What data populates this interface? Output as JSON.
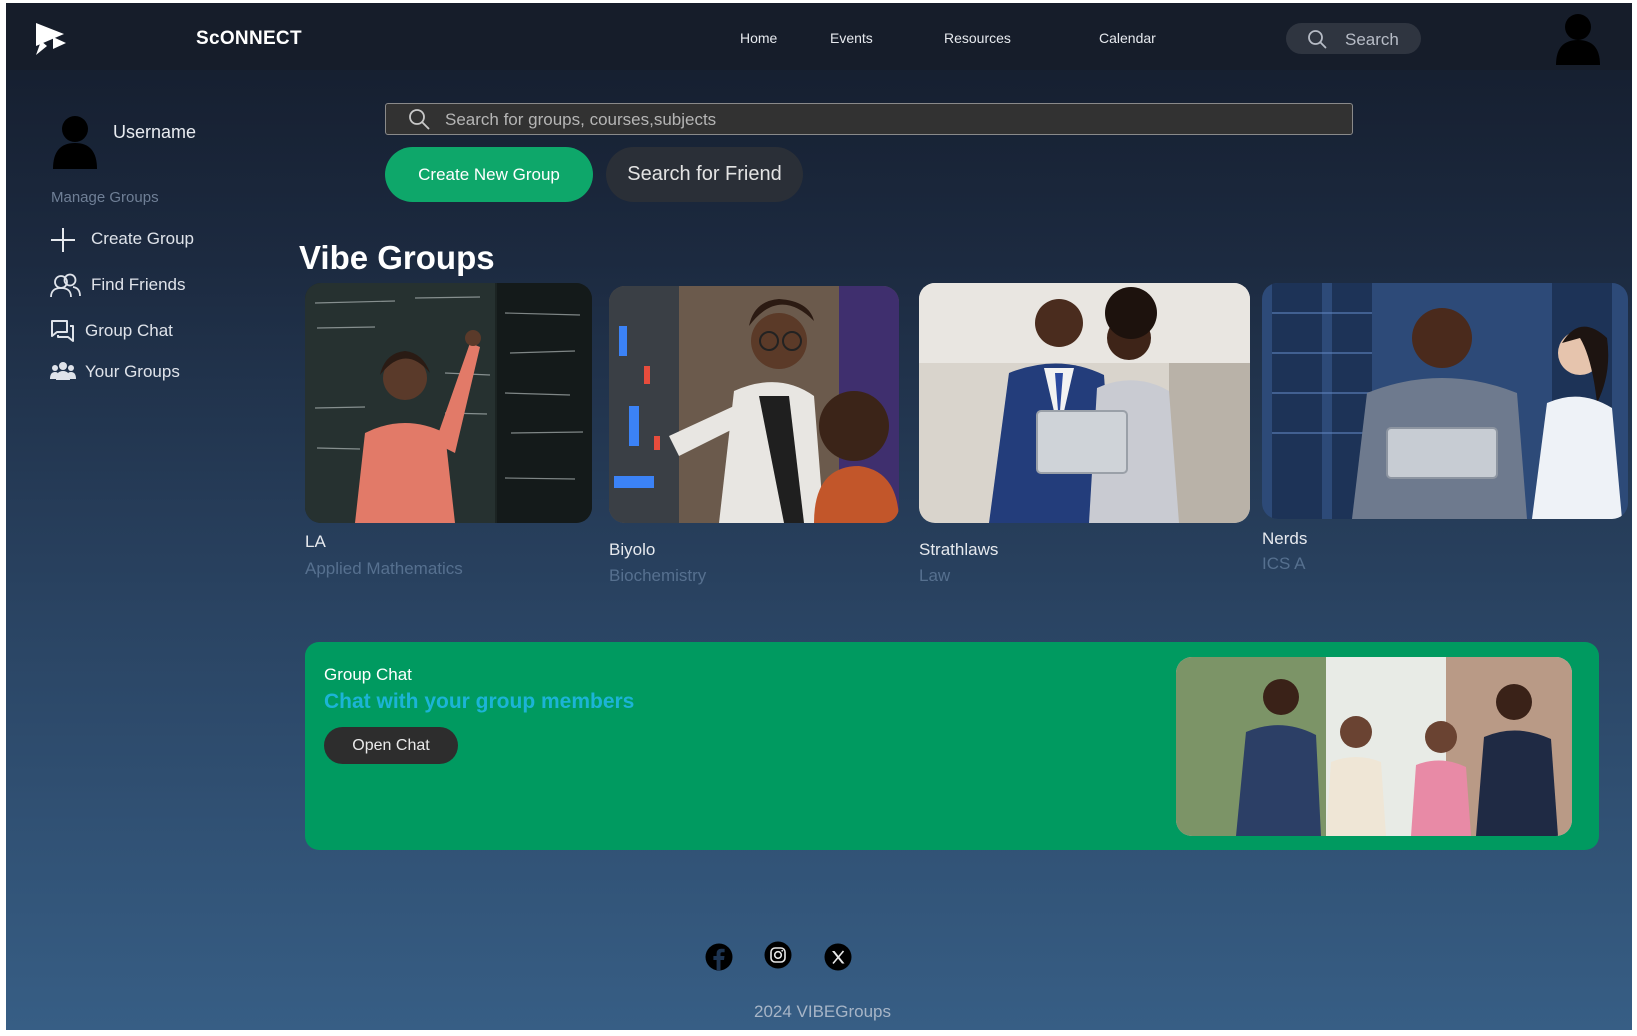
{
  "brand": {
    "name": "ScONNECT",
    "logo_icon": "play-chat-logo-icon"
  },
  "nav": {
    "links": [
      "Home",
      "Events",
      "Resources",
      "Calendar"
    ],
    "search_label": "Search",
    "avatar_icon": "user-avatar-icon"
  },
  "sidebar": {
    "username": "Username",
    "section_label": "Manage Groups",
    "items": [
      {
        "label": "Create Group",
        "icon": "plus-icon"
      },
      {
        "label": "Find Friends",
        "icon": "users-icon"
      },
      {
        "label": "Group Chat",
        "icon": "chat-icon"
      },
      {
        "label": "Your Groups",
        "icon": "groups-icon"
      }
    ]
  },
  "search": {
    "placeholder": "Search for groups, courses,subjects"
  },
  "actions": {
    "create_group": "Create New Group",
    "search_friend": "Search for Friend"
  },
  "groups": {
    "title": "Vibe Groups",
    "items": [
      {
        "name": "LA",
        "subject": "Applied Mathematics"
      },
      {
        "name": "Biyolo",
        "subject": "Biochemistry"
      },
      {
        "name": "Strathlaws",
        "subject": "Law"
      },
      {
        "name": "Nerds",
        "subject": "ICS A"
      }
    ]
  },
  "chat_banner": {
    "title": "Group Chat",
    "subtitle": "Chat with your group members",
    "button": "Open Chat"
  },
  "footer": {
    "social": [
      "facebook-icon",
      "instagram-icon",
      "x-icon"
    ],
    "copyright": "2024 VIBEGroups"
  },
  "colors": {
    "accent_green": "#0ea76a",
    "banner_green": "#009a60",
    "banner_subtitle": "#1cb4d6",
    "nav_bg": "#161d2a"
  }
}
